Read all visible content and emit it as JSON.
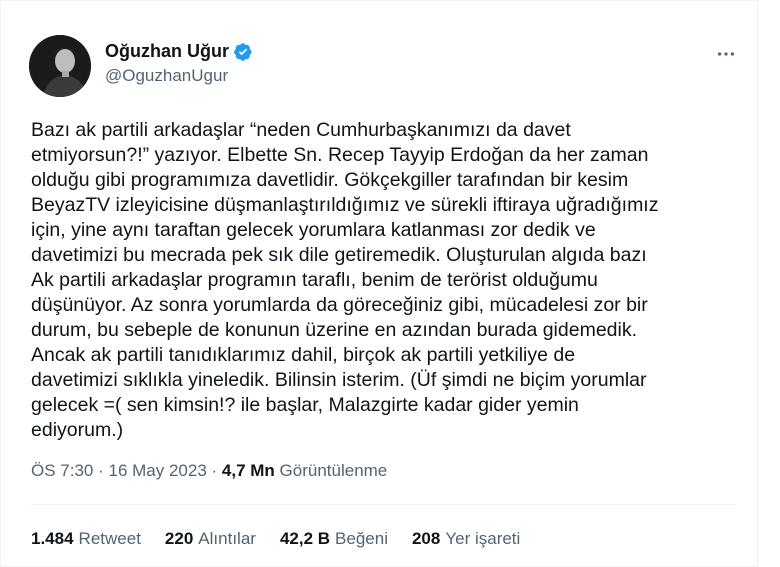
{
  "author": {
    "name": "Oğuzhan Uğur",
    "handle": "@OguzhanUgur"
  },
  "tweet": {
    "text": "Bazı ak partili arkadaşlar “neden Cumhurbaşkanımızı da davet\netmiyorsun?!” yazıyor. Elbette Sn. Recep Tayyip Erdoğan da her zaman\nolduğu gibi programımıza davetlidir. Gökçekgiller tarafından bir kesim\nBeyazTV izleyicisine düşmanlaştırıldığımız ve sürekli iftiraya uğradığımız\niçin, yine aynı taraftan gelecek yorumlara katlanması zor dedik ve\ndavetimizi bu mecrada pek sık dile getiremedik. Oluşturulan algıda bazı\nAk partili arkadaşlar programın taraflı, benim de terörist olduğumu\ndüşünüyor. Az sonra yorumlarda da göreceğiniz gibi, mücadelesi zor bir\ndurum, bu sebeple de konunun üzerine en azından burada gidemedik.\nAncak ak partili tanıdıklarımız dahil, birçok ak partili yetkiliye de\ndavetimizi sıklıkla yineledik. Bilinsin isterim. (Üf şimdi ne biçim yorumlar\ngelecek =( sen kimsin!? ile başlar, Malazgirte kadar gider yemin\nediyorum.)"
  },
  "meta": {
    "time": "ÖS 7:30",
    "sep1": " · ",
    "date": "16 May 2023",
    "sep2": " · ",
    "views_count": "4,7 Mn",
    "views_label": "Görüntülenme"
  },
  "stats": {
    "retweets": {
      "count": "1.484",
      "label": "Retweet"
    },
    "quotes": {
      "count": "220",
      "label": "Alıntılar"
    },
    "likes": {
      "count": "42,2 B",
      "label": "Beğeni"
    },
    "bookmarks": {
      "count": "208",
      "label": "Yer işareti"
    }
  },
  "icons": {
    "verified": "verified-badge-icon",
    "more": "more-horizontal-icon"
  },
  "colors": {
    "verified": "#1d9bf0",
    "secondary_text": "#536471",
    "primary_text": "#0f1419"
  }
}
